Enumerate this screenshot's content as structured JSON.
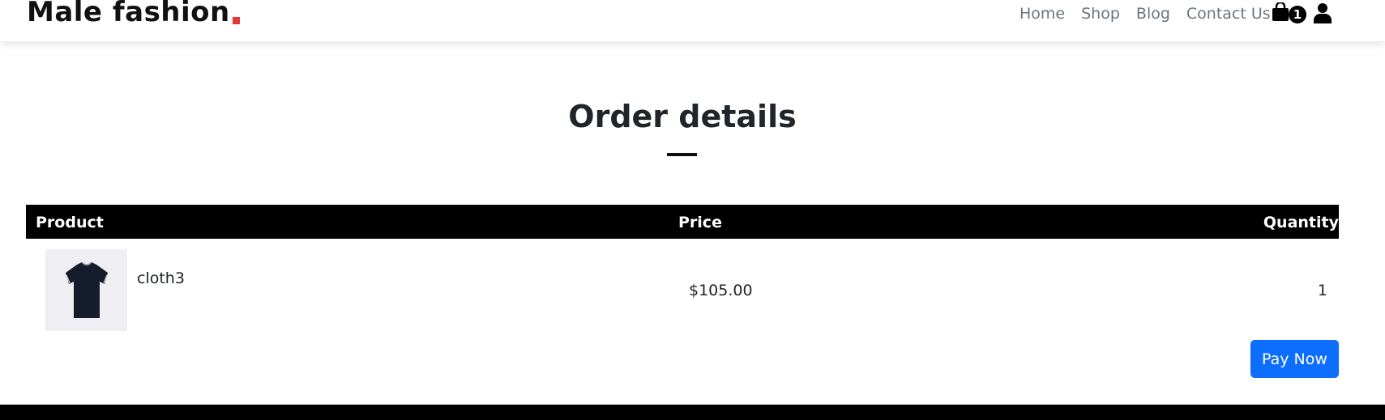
{
  "brand": {
    "name": "Male fashion",
    "accent": "#e53637"
  },
  "nav": {
    "items": [
      {
        "label": "Home"
      },
      {
        "label": "Shop"
      },
      {
        "label": "Blog"
      },
      {
        "label": "Contact Us"
      }
    ],
    "cart_count": "1",
    "cart_icon": "shopping-bag-icon",
    "user_icon": "user-icon"
  },
  "page": {
    "title": "Order details"
  },
  "table": {
    "headers": {
      "product": "Product",
      "price": "Price",
      "quantity": "Quantity"
    },
    "rows": [
      {
        "product": "cloth3",
        "price": "$105.00",
        "quantity": "1",
        "image_icon": "tshirt-image"
      }
    ]
  },
  "actions": {
    "pay_label": "Pay Now",
    "pay_color": "#0d6efd"
  }
}
